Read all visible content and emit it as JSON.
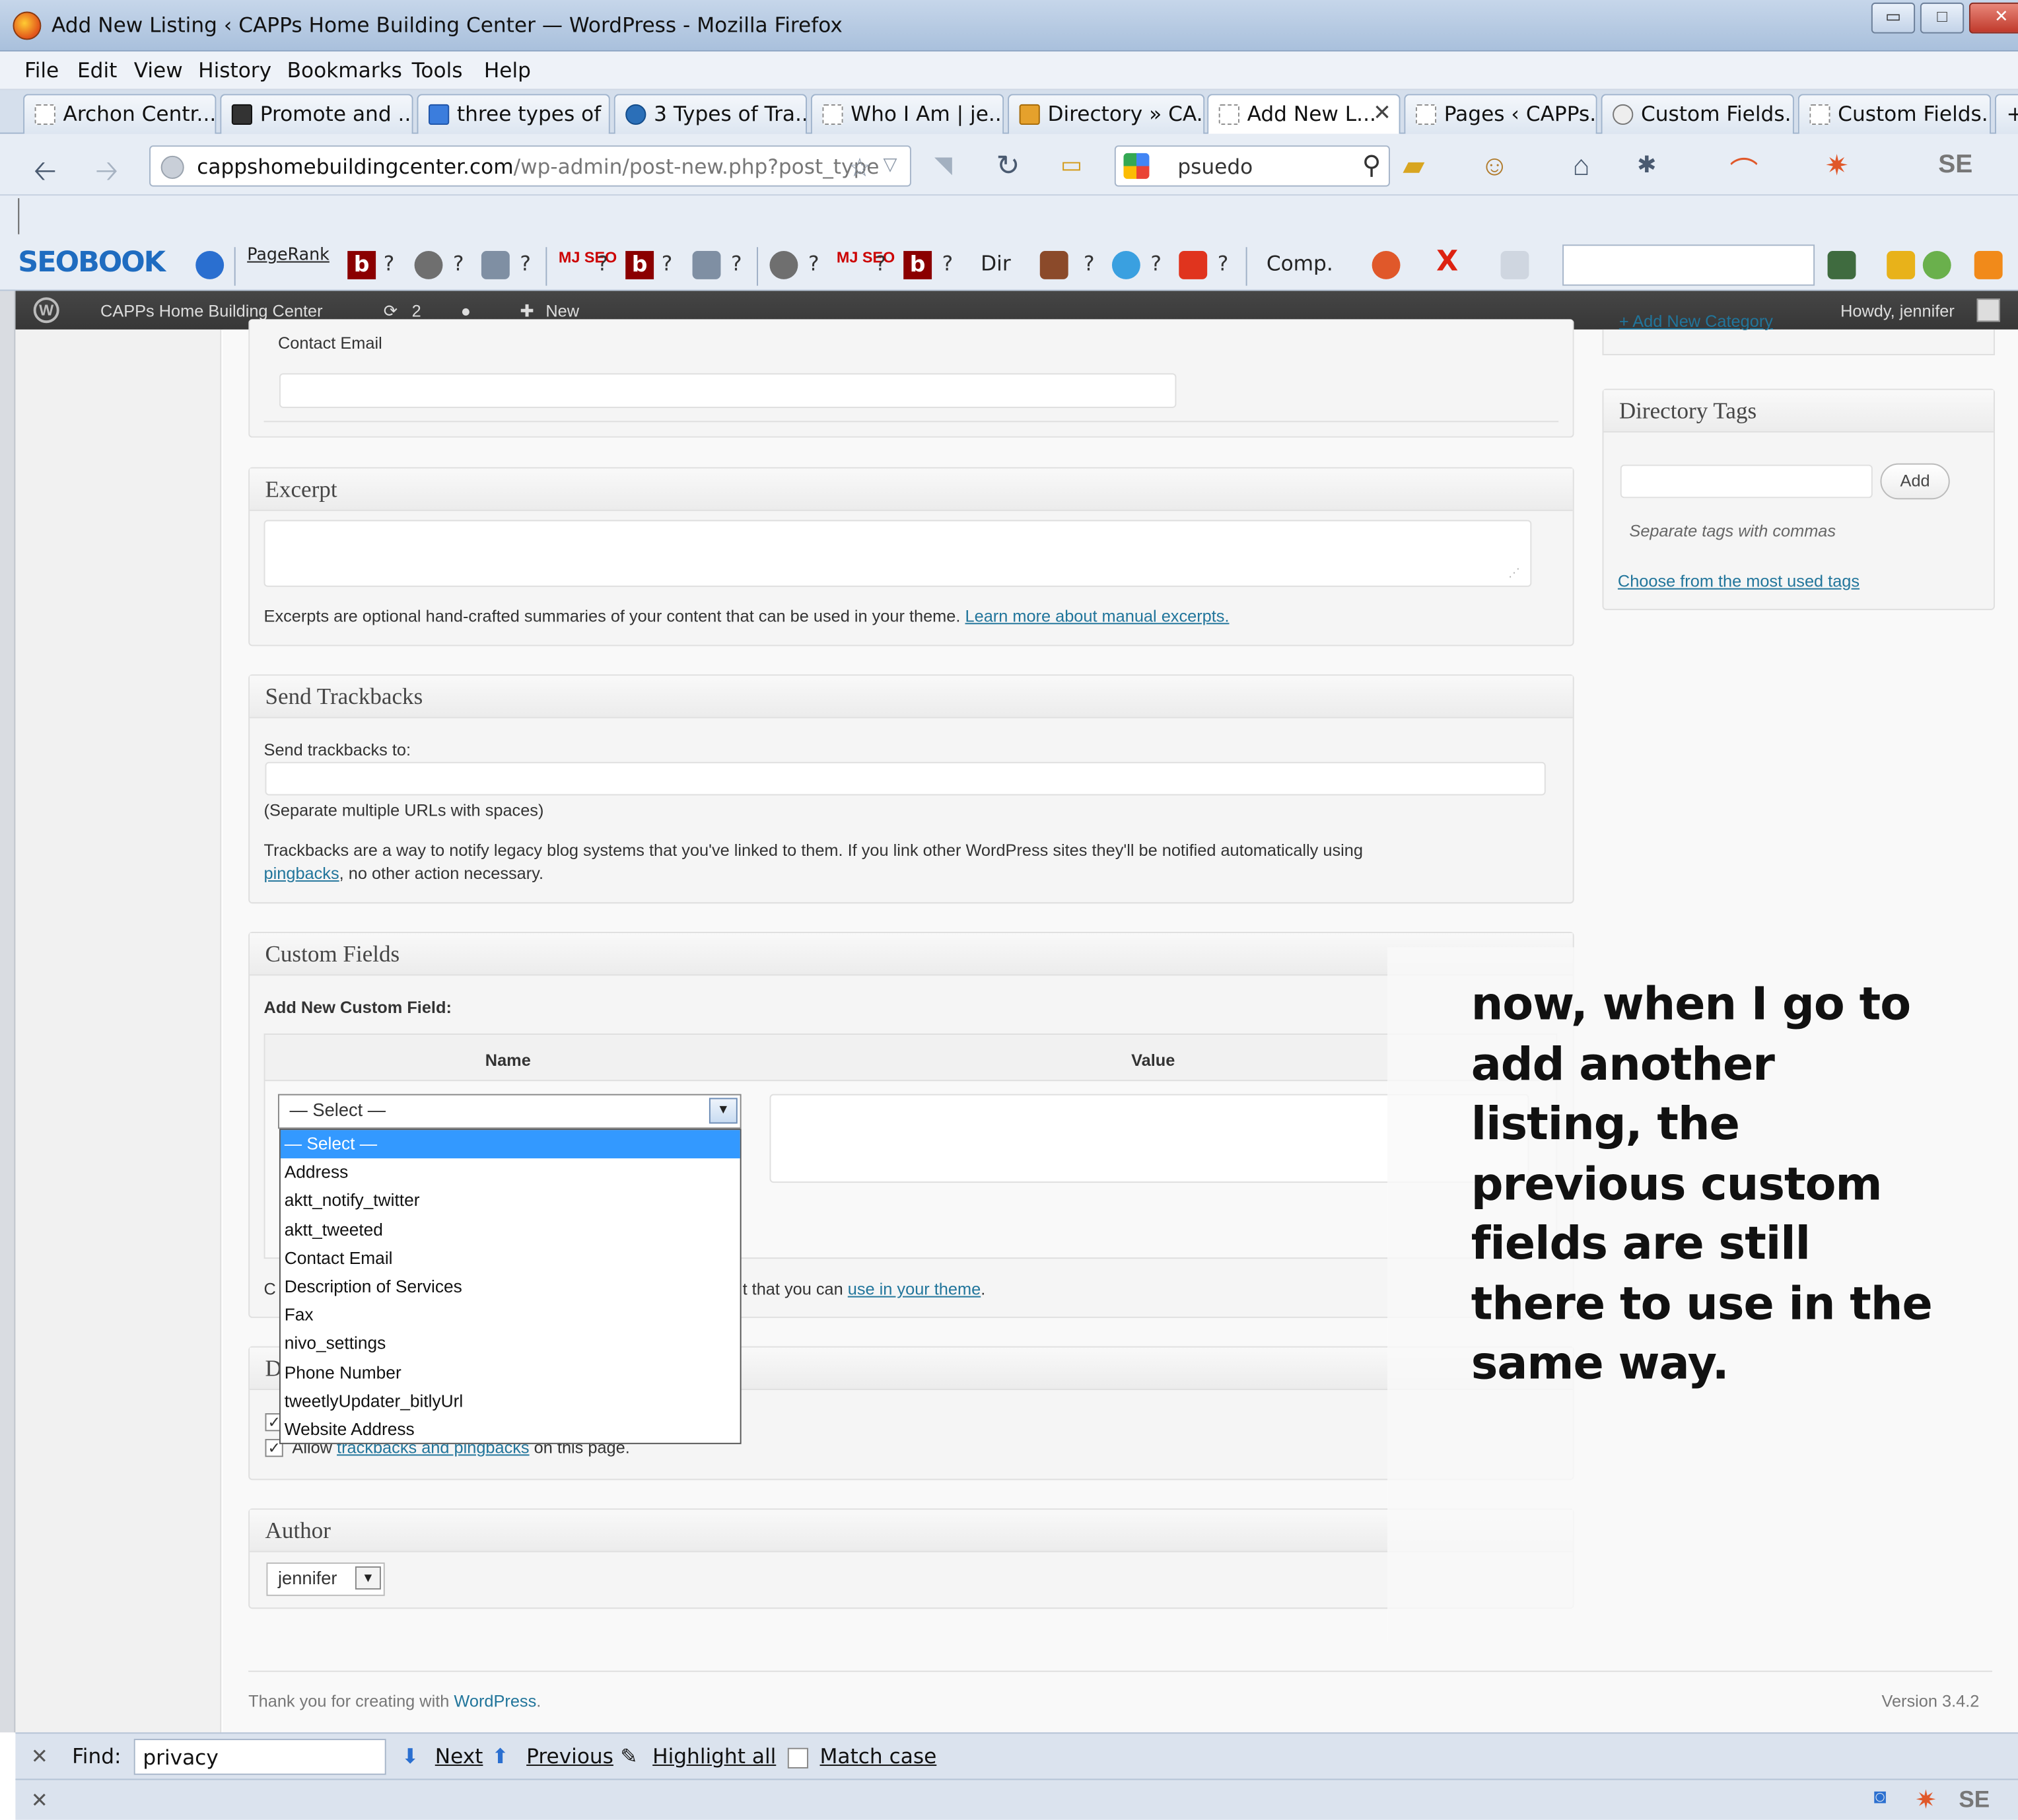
{
  "window": {
    "title": "Add New Listing ‹ CAPPs Home Building Center — WordPress - Mozilla Firefox",
    "controls": {
      "minimize": "▭",
      "maximize": "□",
      "close": "✕"
    }
  },
  "menubar": [
    "File",
    "Edit",
    "View",
    "History",
    "Bookmarks",
    "Tools",
    "Help"
  ],
  "tabs": [
    {
      "label": "Archon Centr...",
      "icon": "blank-page-icon"
    },
    {
      "label": "Promote and ...",
      "icon": "g-logo-icon"
    },
    {
      "label": "three types of ...",
      "icon": "google-icon"
    },
    {
      "label": "3 Types of Tra...",
      "icon": "globe-icon"
    },
    {
      "label": "Who I Am | je...",
      "icon": "blank-page-icon"
    },
    {
      "label": "Directory » CA...",
      "icon": "directory-icon"
    },
    {
      "label": "Add New L...",
      "icon": "blank-page-icon",
      "active": true
    },
    {
      "label": "Pages ‹ CAPPs...",
      "icon": "blank-page-icon"
    },
    {
      "label": "Custom Fields...",
      "icon": "wordpress-icon"
    },
    {
      "label": "Custom Fields...",
      "icon": "blank-page-icon"
    }
  ],
  "tab_close": "✕",
  "new_tab": "+",
  "navbar": {
    "url_domain": "cappshomebuildingcenter.com",
    "url_path": "/wp-admin/post-new.php?post_type",
    "search_value": "psuedo"
  },
  "seobar": {
    "logo_a": "SE",
    "logo_b": "O",
    "logo_c": "BOOK",
    "pagerank": "PageRank",
    "b": "b",
    "q": "?",
    "mj": "MJ SEO",
    "dir": "Dir",
    "comp": "Comp.",
    "x": "X"
  },
  "adminbar": {
    "site_name": "CAPPs Home Building Center",
    "updates": "2",
    "new": "New",
    "howdy": "Howdy, jennifer"
  },
  "contact_email": {
    "label": "Contact Email",
    "value": ""
  },
  "excerpt": {
    "title": "Excerpt",
    "help": "Excerpts are optional hand-crafted summaries of your content that can be used in your theme.",
    "link": "Learn more about manual excerpts."
  },
  "trackbacks": {
    "title": "Send Trackbacks",
    "label": "Send trackbacks to:",
    "hint": "(Separate multiple URLs with spaces)",
    "desc": "Trackbacks are a way to notify legacy blog systems that you've linked to them. If you link other WordPress sites they'll be notified automatically using",
    "desc_link": "pingbacks",
    "desc_tail": ", no other action necessary."
  },
  "custom_fields": {
    "title": "Custom Fields",
    "add_label": "Add New Custom Field:",
    "col_name": "Name",
    "col_value": "Value",
    "selected": "— Select —",
    "options": [
      "— Select —",
      "Address",
      "aktt_notify_twitter",
      "aktt_tweeted",
      "Contact Email",
      "Description of Services",
      "Fax",
      "nivo_settings",
      "Phone Number",
      "tweetlyUpdater_bitlyUrl",
      "Website Address"
    ],
    "footer_lead": "C",
    "footer_text": "t that you can",
    "footer_link": "use in your theme"
  },
  "discussion": {
    "title_initial": "D",
    "allow_text": "Allow",
    "allow_link": "trackbacks and pingbacks",
    "allow_tail": "on this page."
  },
  "author": {
    "title": "Author",
    "value": "jennifer"
  },
  "footer": {
    "thanks": "Thank you for creating with",
    "wp_link": "WordPress",
    "version": "Version 3.4.2"
  },
  "sidebar": {
    "category_link": "+ Add New Category",
    "tags_title": "Directory Tags",
    "add_button": "Add",
    "tags_hint": "Separate tags with commas",
    "choose_link": "Choose from the most used tags"
  },
  "annotation": "now, when I go to add another listing, the previous custom fields are still there to use in the same way.",
  "findbar": {
    "close": "✕",
    "find_label": "Find:",
    "value": "privacy",
    "next": "Next",
    "previous": "Previous",
    "highlight": "Highlight all",
    "match_case": "Match case"
  },
  "statusbar": {
    "close": "✕"
  }
}
